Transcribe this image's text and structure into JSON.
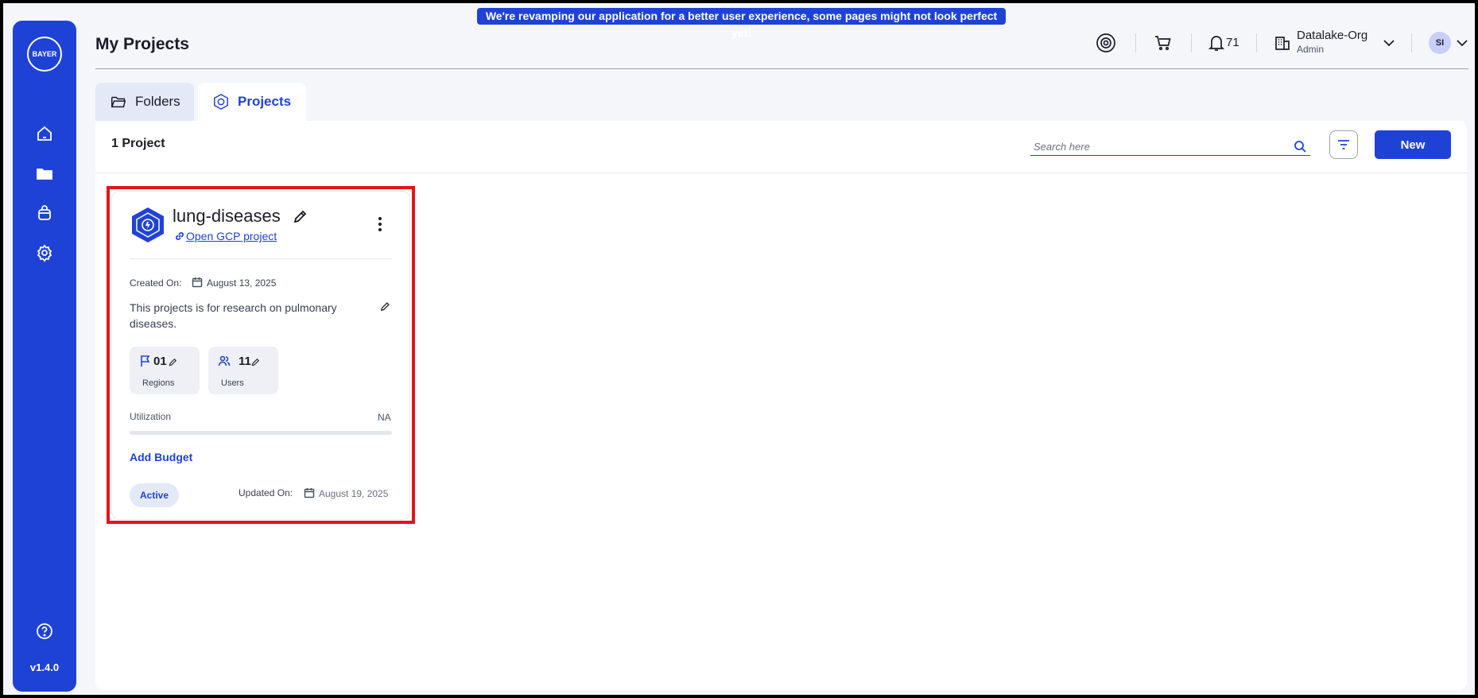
{
  "banner": {
    "text": "We're revamping our application for a better user experience, some pages might not look perfect yet!"
  },
  "sidebar": {
    "logo_text": "BAYER",
    "items": [
      {
        "icon": "home-icon"
      },
      {
        "icon": "folder-icon"
      },
      {
        "icon": "bag-icon"
      },
      {
        "icon": "gear-icon"
      }
    ],
    "help_icon": "help-icon",
    "version": "v1.4.0"
  },
  "header": {
    "title": "My Projects",
    "notifications_count": "71",
    "org_name": "Datalake-Org",
    "org_role": "Admin",
    "avatar_initials": "SI"
  },
  "tabs": [
    {
      "label": "Folders",
      "active": false
    },
    {
      "label": "Projects",
      "active": true
    }
  ],
  "toolbar": {
    "count_label": "1 Project",
    "search_placeholder": "Search here",
    "new_label": "New"
  },
  "project": {
    "name": "lung-diseases",
    "gcp_link": "Open GCP project",
    "created_label": "Created On:",
    "created_date": "August 13, 2025",
    "description": "This projects is for research on pulmonary diseases.",
    "regions_value": "01",
    "regions_label": "Regions",
    "users_value": "11",
    "users_label": "Users",
    "utilization_label": "Utilization",
    "utilization_value": "NA",
    "add_budget": "Add Budget",
    "status": "Active",
    "updated_label": "Updated On:",
    "updated_date": "August 19, 2025"
  },
  "colors": {
    "brand": "#1f42d6",
    "highlight": "#e3141c"
  }
}
